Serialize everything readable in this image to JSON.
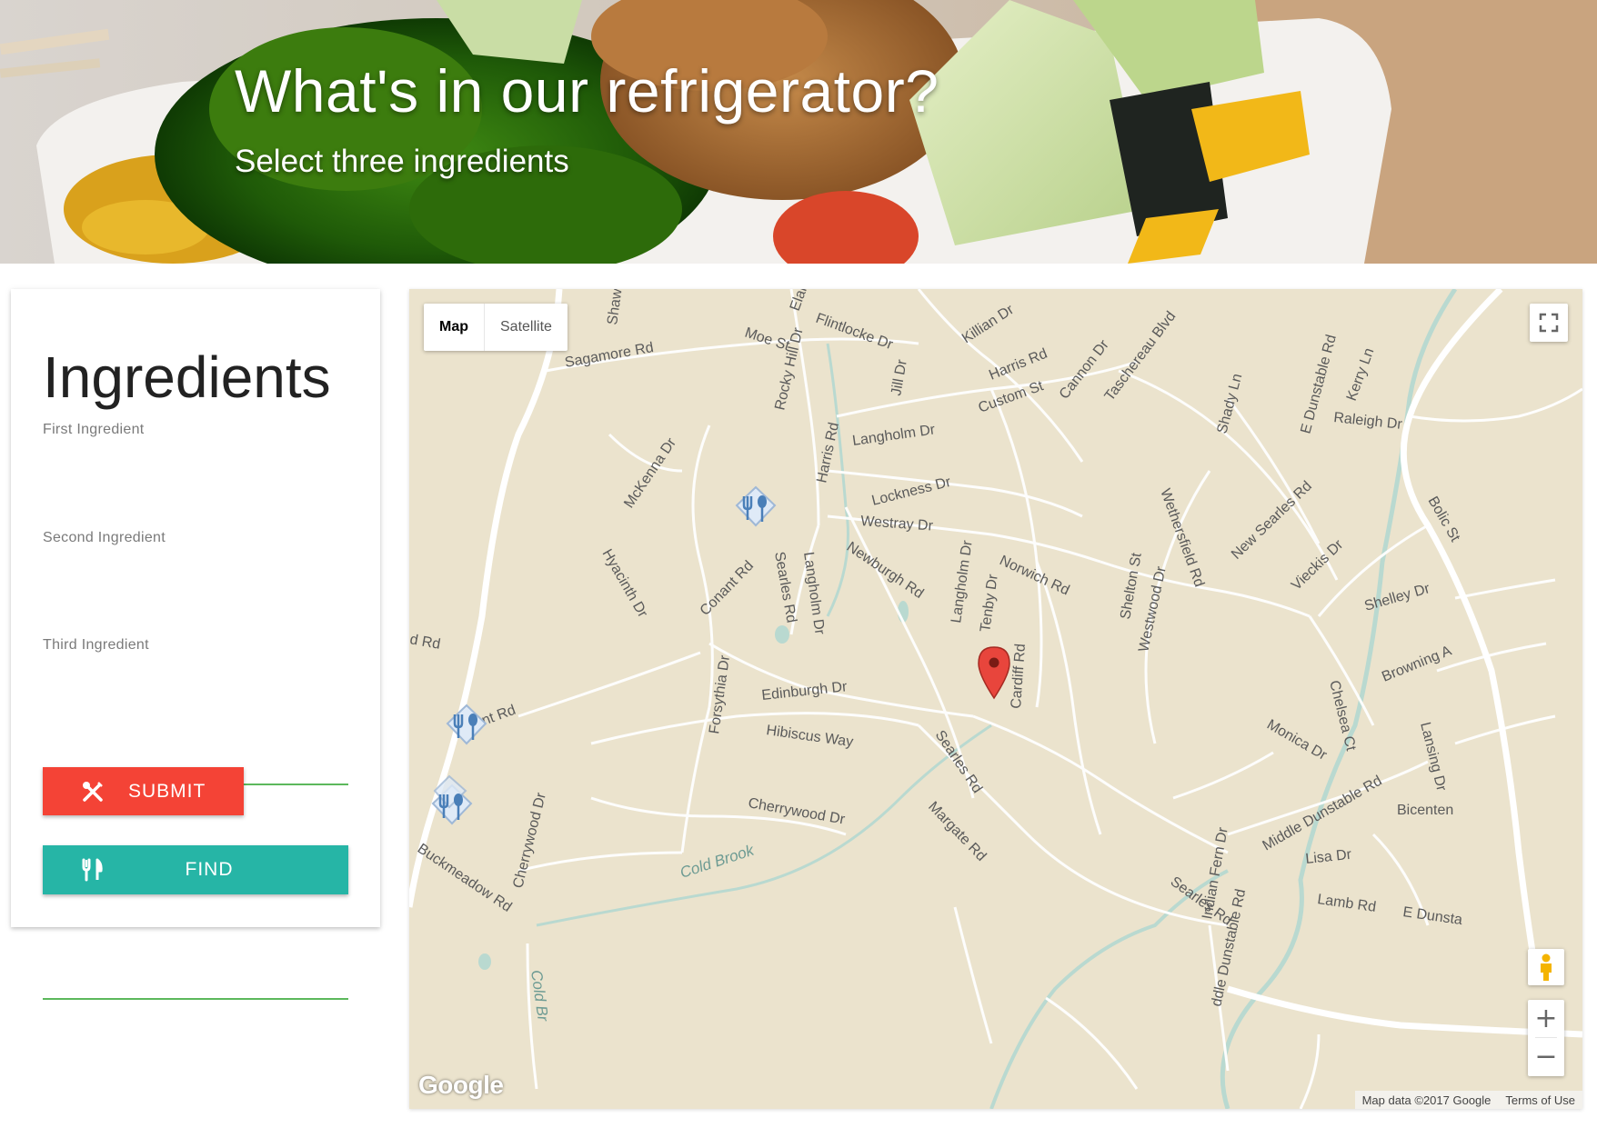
{
  "hero": {
    "title": "What's in our refrigerator?",
    "subtitle": "Select three ingredients"
  },
  "form": {
    "title": "Ingredients",
    "fields": [
      {
        "label": "First Ingredient",
        "value": ""
      },
      {
        "label": "Second Ingredient",
        "value": ""
      },
      {
        "label": "Third Ingredient",
        "value": ""
      }
    ],
    "submit_label": "SUBMIT",
    "submit_icon": "utensils-crossed-icon",
    "find_label": "FIND",
    "find_icon": "fork-knife-icon"
  },
  "map": {
    "type_options": [
      "Map",
      "Satellite"
    ],
    "active_type": "Map",
    "logo": "Google",
    "attribution": "Map data ©2017 Google",
    "terms": "Terms of Use",
    "zoom_in": "+",
    "zoom_out": "−",
    "streets": [
      "Shaw",
      "Elai",
      "Moe St",
      "Flintlocke Dr",
      "Killian Dr",
      "Harris Rd",
      "Custom St",
      "Cannon Dr",
      "Taschereau Blvd",
      "Sagamore Rd",
      "Rocky Hill Dr",
      "Jill Dr",
      "Shady Ln",
      "E Dunstable Rd",
      "Kerry Ln",
      "Raleigh Dr",
      "Langholm Dr",
      "McKenna Dr",
      "Harris Rd",
      "Lockness Dr",
      "Westray Dr",
      "Newburgh Rd",
      "Norwich Rd",
      "Wethersfield Rd",
      "New Searles Rd",
      "Bolic St",
      "Shelton St",
      "Westwood Dr",
      "Vieckis Dr",
      "Shelley Dr",
      "Hyacinth Dr",
      "Conant Rd",
      "Searles Rd",
      "Langholm Dr",
      "Langholm Dr",
      "Tenby Dr",
      "Browning A",
      "Edinburgh Dr",
      "Forsythia Dr",
      "Cardiff Rd",
      "Chelsea Ct",
      "Lansing Dr",
      "Hibiscus Way",
      "Searles Rd",
      "Monica Dr",
      "Cherrywood Dr",
      "Margate Rd",
      "Middle Dunstable Rd",
      "Bicenten",
      "Buckmeadow Rd",
      "Cherrywood Dr",
      "Cold Brook",
      "Indian Fern Dr",
      "Lisa Dr",
      "Searles Rd",
      "Lamb Rd",
      "E Dunsta",
      "ddle Dunstable Rd",
      "Cold Br",
      "d Rd",
      "nt Rd"
    ],
    "markers": [
      "restaurant-icon",
      "restaurant-icon",
      "restaurant-icon",
      "location-pin-icon"
    ]
  }
}
